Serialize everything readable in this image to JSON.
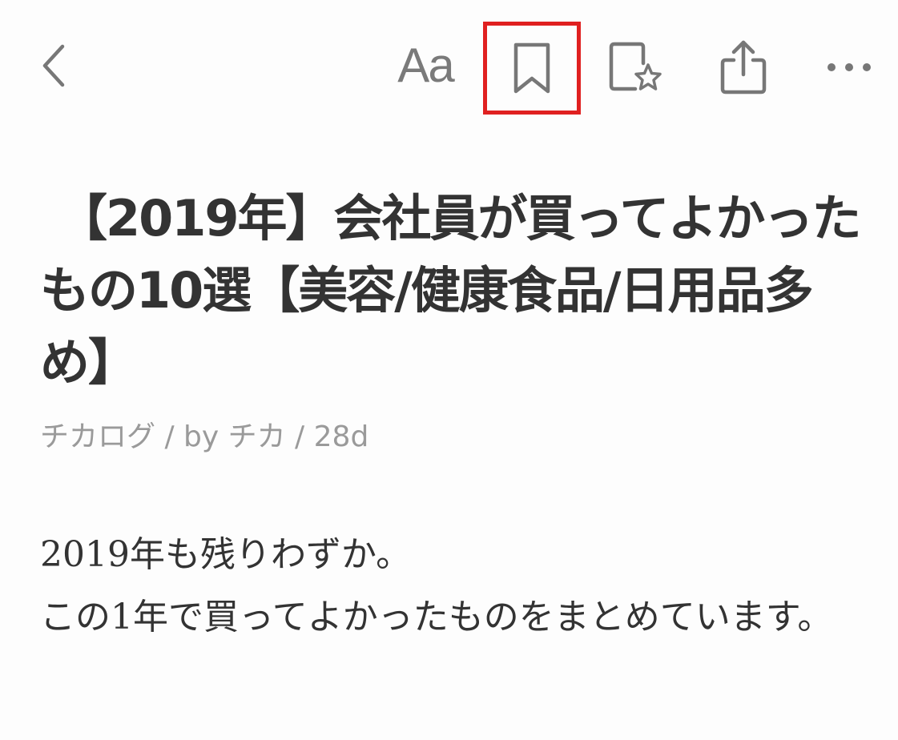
{
  "toolbar": {
    "back_icon": "chevron-left-icon",
    "font_label": "Aa",
    "bookmark_icon": "bookmark-icon",
    "favorite_icon": "page-star-icon",
    "share_icon": "share-icon",
    "more_icon": "ellipsis-icon",
    "highlight_color": "#e02020"
  },
  "article": {
    "title": "【2019年】会社員が買ってよかったもの10選【美容/健康食品/日用品多め】",
    "meta": "チカログ / by チカ / 28d",
    "paragraphs": [
      "2019年も残りわずか。",
      "この1年で買ってよかったものをまとめています。"
    ]
  }
}
